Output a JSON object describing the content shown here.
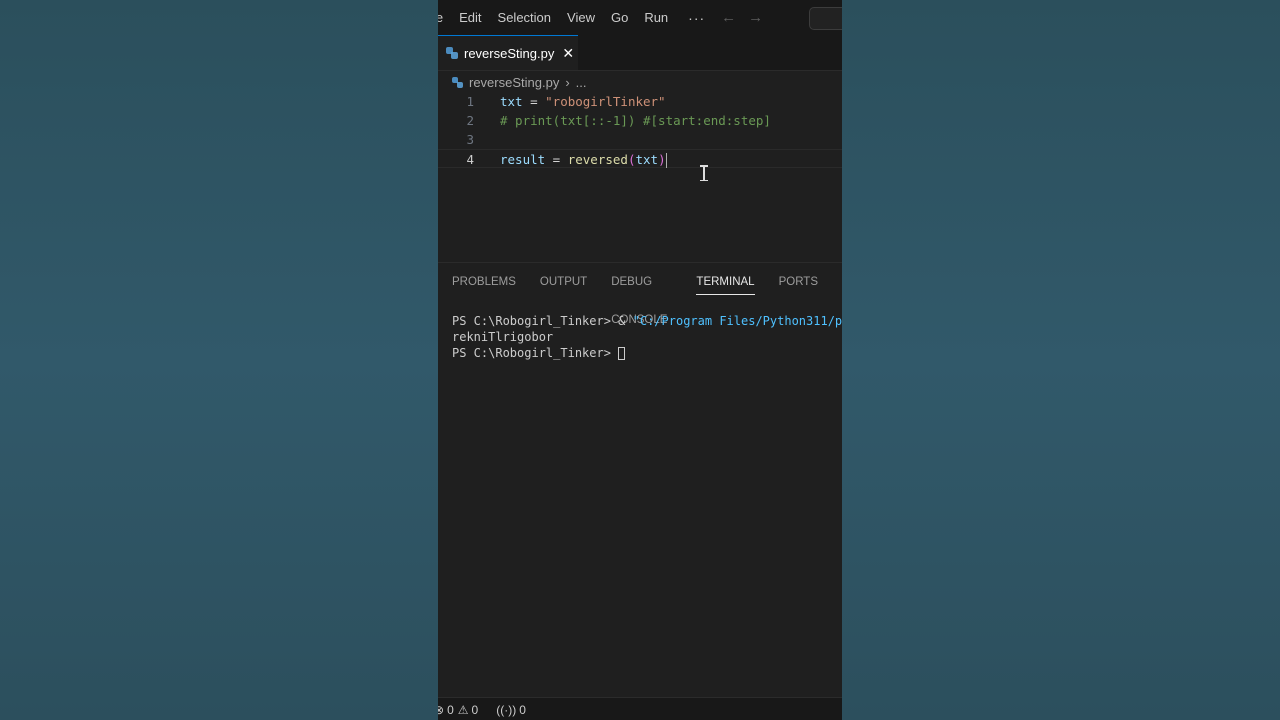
{
  "menubar": {
    "items": [
      "le",
      "Edit",
      "Selection",
      "View",
      "Go",
      "Run"
    ],
    "more": "···",
    "back_icon": "arrow-left-icon",
    "forward_icon": "arrow-right-icon"
  },
  "tabs": [
    {
      "label": "reverseSting.py",
      "icon": "python-icon",
      "close": "✕",
      "active": true
    }
  ],
  "breadcrumb": {
    "file": "reverseSting.py",
    "separator": "›",
    "more": "..."
  },
  "editor": {
    "current_line": 4,
    "lines": [
      {
        "number": "1",
        "text": "txt = \"robogirlTinker\""
      },
      {
        "number": "2",
        "text": "# print(txt[::-1]) #[start:end:step]"
      },
      {
        "number": "3",
        "text": ""
      },
      {
        "number": "4",
        "text": "result = reversed(txt)"
      }
    ],
    "tokens": {
      "l1_var": "txt",
      "l1_op": " = ",
      "l1_str": "\"robogirlTinker\"",
      "l2_com": "# print(txt[::-1]) #[start:end:step]",
      "l4_var": "result",
      "l4_op": " = ",
      "l4_fn": "reversed",
      "l4_open": "(",
      "l4_arg": "txt",
      "l4_close": ")"
    }
  },
  "panel": {
    "tabs": [
      "PROBLEMS",
      "OUTPUT",
      "DEBUG CONSOLE",
      "TERMINAL",
      "PORTS"
    ],
    "active_tab": "TERMINAL",
    "terminal": {
      "line1_prompt": "PS C:\\Robogirl_Tinker> ",
      "line1_amp": "& ",
      "line1_str": "\"C:/Program Files/Python311/p",
      "line2": "rekniTlrigobor",
      "line3_prompt": "PS C:\\Robogirl_Tinker> "
    }
  },
  "statusbar": {
    "errors": "0",
    "warnings": "0",
    "ports": "0"
  },
  "colors": {
    "background": "#2f5461",
    "editor_bg": "#1f1f1f",
    "accent": "#0078d4"
  }
}
